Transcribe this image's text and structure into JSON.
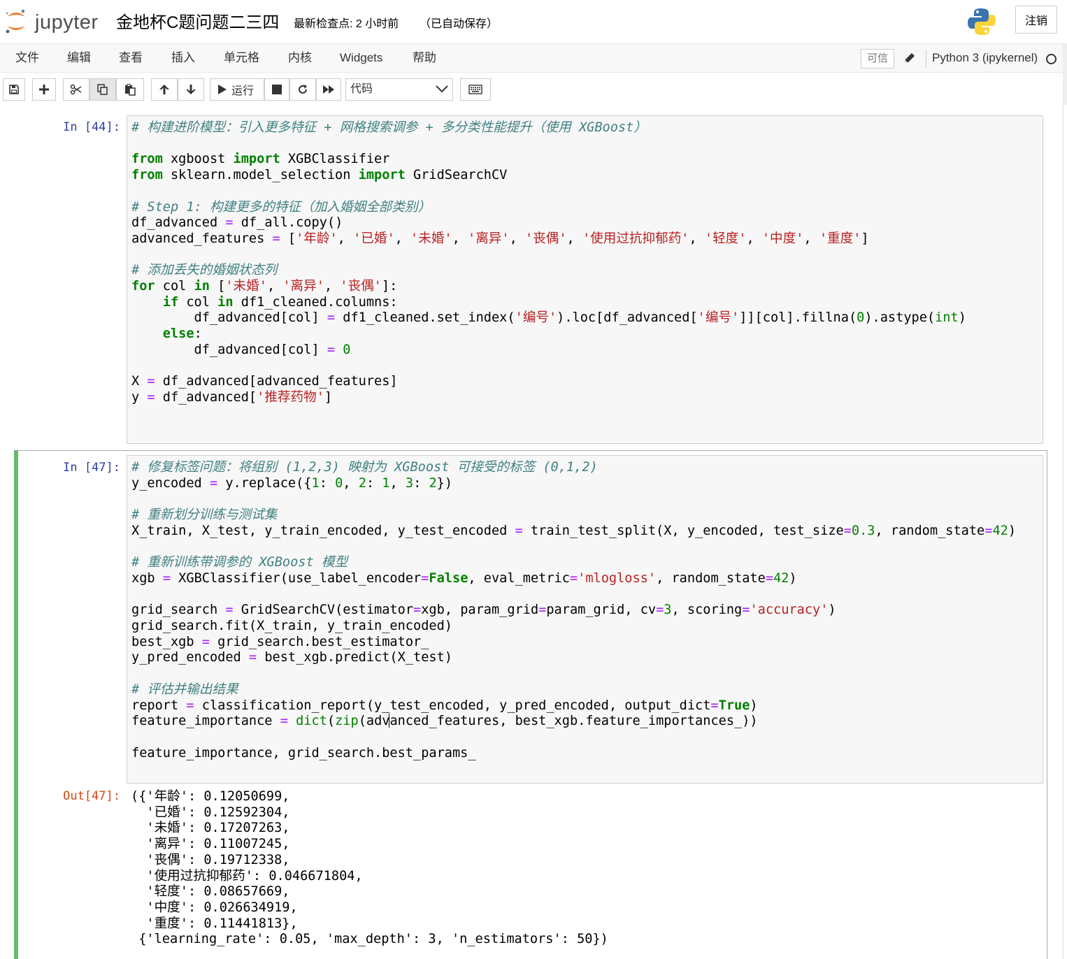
{
  "header": {
    "logo_text": "jupyter",
    "notebook_title": "金地杯C题问题二三四",
    "checkpoint": "最新检查点: 2 小时前",
    "autosave": "（已自动保存）",
    "logout_label": "注销"
  },
  "menubar": {
    "items": [
      "文件",
      "编辑",
      "查看",
      "插入",
      "单元格",
      "内核",
      "Widgets",
      "帮助"
    ],
    "trusted_label": "可信",
    "kernel_name": "Python 3 (ipykernel)"
  },
  "toolbar": {
    "run_label": "运行",
    "cell_type": "代码"
  },
  "cells": [
    {
      "prompt": "In [44]:",
      "code": [
        "# 构建进阶模型：引入更多特征 + 网格搜索调参 + 多分类性能提升（使用 XGBoost）",
        "",
        "from xgboost import XGBClassifier",
        "from sklearn.model_selection import GridSearchCV",
        "",
        "# Step 1: 构建更多的特征（加入婚姻全部类别）",
        "df_advanced = df_all.copy()",
        "advanced_features = ['年龄', '已婚', '未婚', '离异', '丧偶', '使用过抗抑郁药', '轻度', '中度', '重度']",
        "",
        "# 添加丢失的婚姻状态列",
        "for col in ['未婚', '离异', '丧偶']:",
        "    if col in df1_cleaned.columns:",
        "        df_advanced[col] = df1_cleaned.set_index('编号').loc[df_advanced['编号']][col].fillna(0).astype(int)",
        "    else:",
        "        df_advanced[col] = 0",
        "",
        "X = df_advanced[advanced_features]",
        "y = df_advanced['推荐药物']"
      ]
    },
    {
      "prompt": "In [47]:",
      "out_prompt": "Out[47]:",
      "code": [
        "# 修复标签问题：将组别 (1,2,3) 映射为 XGBoost 可接受的标签 (0,1,2)",
        "y_encoded = y.replace({1: 0, 2: 1, 3: 2})",
        "",
        "# 重新划分训练与测试集",
        "X_train, X_test, y_train_encoded, y_test_encoded = train_test_split(X, y_encoded, test_size=0.3, random_state=42)",
        "",
        "# 重新训练带调参的 XGBoost 模型",
        "xgb = XGBClassifier(use_label_encoder=False, eval_metric='mlogloss', random_state=42)",
        "",
        "grid_search = GridSearchCV(estimator=xgb, param_grid=param_grid, cv=3, scoring='accuracy')",
        "grid_search.fit(X_train, y_train_encoded)",
        "best_xgb = grid_search.best_estimator_",
        "y_pred_encoded = best_xgb.predict(X_test)",
        "",
        "# 评估并输出结果",
        "report = classification_report(y_test_encoded, y_pred_encoded, output_dict=True)",
        "feature_importance = dict(zip(advanced_features, best_xgb.feature_importances_))",
        "",
        "feature_importance, grid_search.best_params_"
      ],
      "output": [
        "({'年龄': 0.12050699,",
        "  '已婚': 0.12592304,",
        "  '未婚': 0.17207263,",
        "  '离异': 0.11007245,",
        "  '丧偶': 0.19712338,",
        "  '使用过抗抑郁药': 0.046671804,",
        "  '轻度': 0.08657669,",
        "  '中度': 0.026634919,",
        "  '重度': 0.11441813},",
        " {'learning_rate': 0.05, 'max_depth': 3, 'n_estimators': 50})"
      ]
    }
  ],
  "icons": [
    "jupyter-logo-icon",
    "python-logo-icon",
    "pencil-icon",
    "kernel-idle-icon",
    "save-icon",
    "plus-icon",
    "scissors-icon",
    "copy-icon",
    "paste-icon",
    "arrow-up-icon",
    "arrow-down-icon",
    "play-icon",
    "stop-icon",
    "restart-icon",
    "fast-forward-icon",
    "keyboard-icon",
    "chevron-down-icon"
  ],
  "colors": {
    "selected_cell_border": "#66bb6a",
    "prompt_in": "#303f9f",
    "prompt_out": "#d84315",
    "keyword": "#008000",
    "string": "#ba2121",
    "operator": "#aa22ff",
    "comment": "#408080"
  }
}
